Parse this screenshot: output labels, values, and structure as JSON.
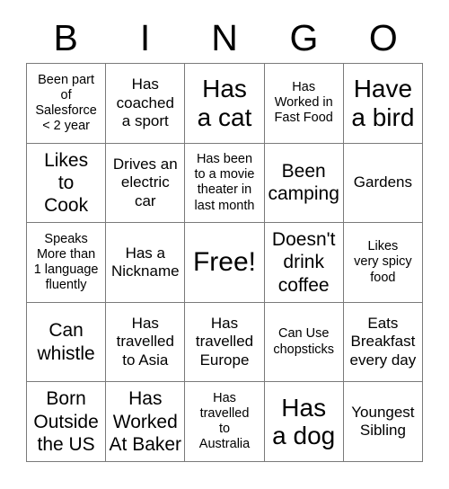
{
  "card": {
    "title": "BINGO",
    "header_letters": [
      "B",
      "I",
      "N",
      "G",
      "O"
    ],
    "free_space_label": "Free!",
    "rows": [
      {
        "cells": [
          {
            "text": "Been part\nof\nSalesforce\n< 2 year",
            "size": "sz-s"
          },
          {
            "text": "Has\ncoached\na sport",
            "size": "sz-m"
          },
          {
            "text": "Has\na cat",
            "size": "sz-xl"
          },
          {
            "text": "Has\nWorked in\nFast Food",
            "size": "sz-s"
          },
          {
            "text": "Have\na bird",
            "size": "sz-xl"
          }
        ]
      },
      {
        "cells": [
          {
            "text": "Likes\nto\nCook",
            "size": "sz-l"
          },
          {
            "text": "Drives an\nelectric\ncar",
            "size": "sz-m"
          },
          {
            "text": "Has been\nto a movie\ntheater in\nlast month",
            "size": "sz-s"
          },
          {
            "text": "Been\ncamping",
            "size": "sz-l"
          },
          {
            "text": "Gardens",
            "size": "sz-m"
          }
        ]
      },
      {
        "cells": [
          {
            "text": "Speaks\nMore than\n1 language\nfluently",
            "size": "sz-s"
          },
          {
            "text": "Has a\nNickname",
            "size": "sz-m"
          },
          {
            "text": "Free!",
            "size": "sz-free"
          },
          {
            "text": "Doesn't\ndrink\ncoffee",
            "size": "sz-l"
          },
          {
            "text": "Likes\nvery spicy\nfood",
            "size": "sz-s"
          }
        ]
      },
      {
        "cells": [
          {
            "text": "Can\nwhistle",
            "size": "sz-l"
          },
          {
            "text": "Has\ntravelled\nto Asia",
            "size": "sz-m"
          },
          {
            "text": "Has\ntravelled\nEurope",
            "size": "sz-m"
          },
          {
            "text": "Can Use\nchopsticks",
            "size": "sz-s"
          },
          {
            "text": "Eats\nBreakfast\nevery day",
            "size": "sz-m"
          }
        ]
      },
      {
        "cells": [
          {
            "text": "Born\nOutside\nthe US",
            "size": "sz-l"
          },
          {
            "text": "Has\nWorked\nAt Baker",
            "size": "sz-l"
          },
          {
            "text": "Has\ntravelled\nto\nAustralia",
            "size": "sz-s"
          },
          {
            "text": "Has\na dog",
            "size": "sz-xl"
          },
          {
            "text": "Youngest\nSibling",
            "size": "sz-m"
          }
        ]
      }
    ]
  },
  "colors": {
    "background": "#ffffff",
    "grid_line": "#7a7a7a",
    "text": "#000000"
  }
}
